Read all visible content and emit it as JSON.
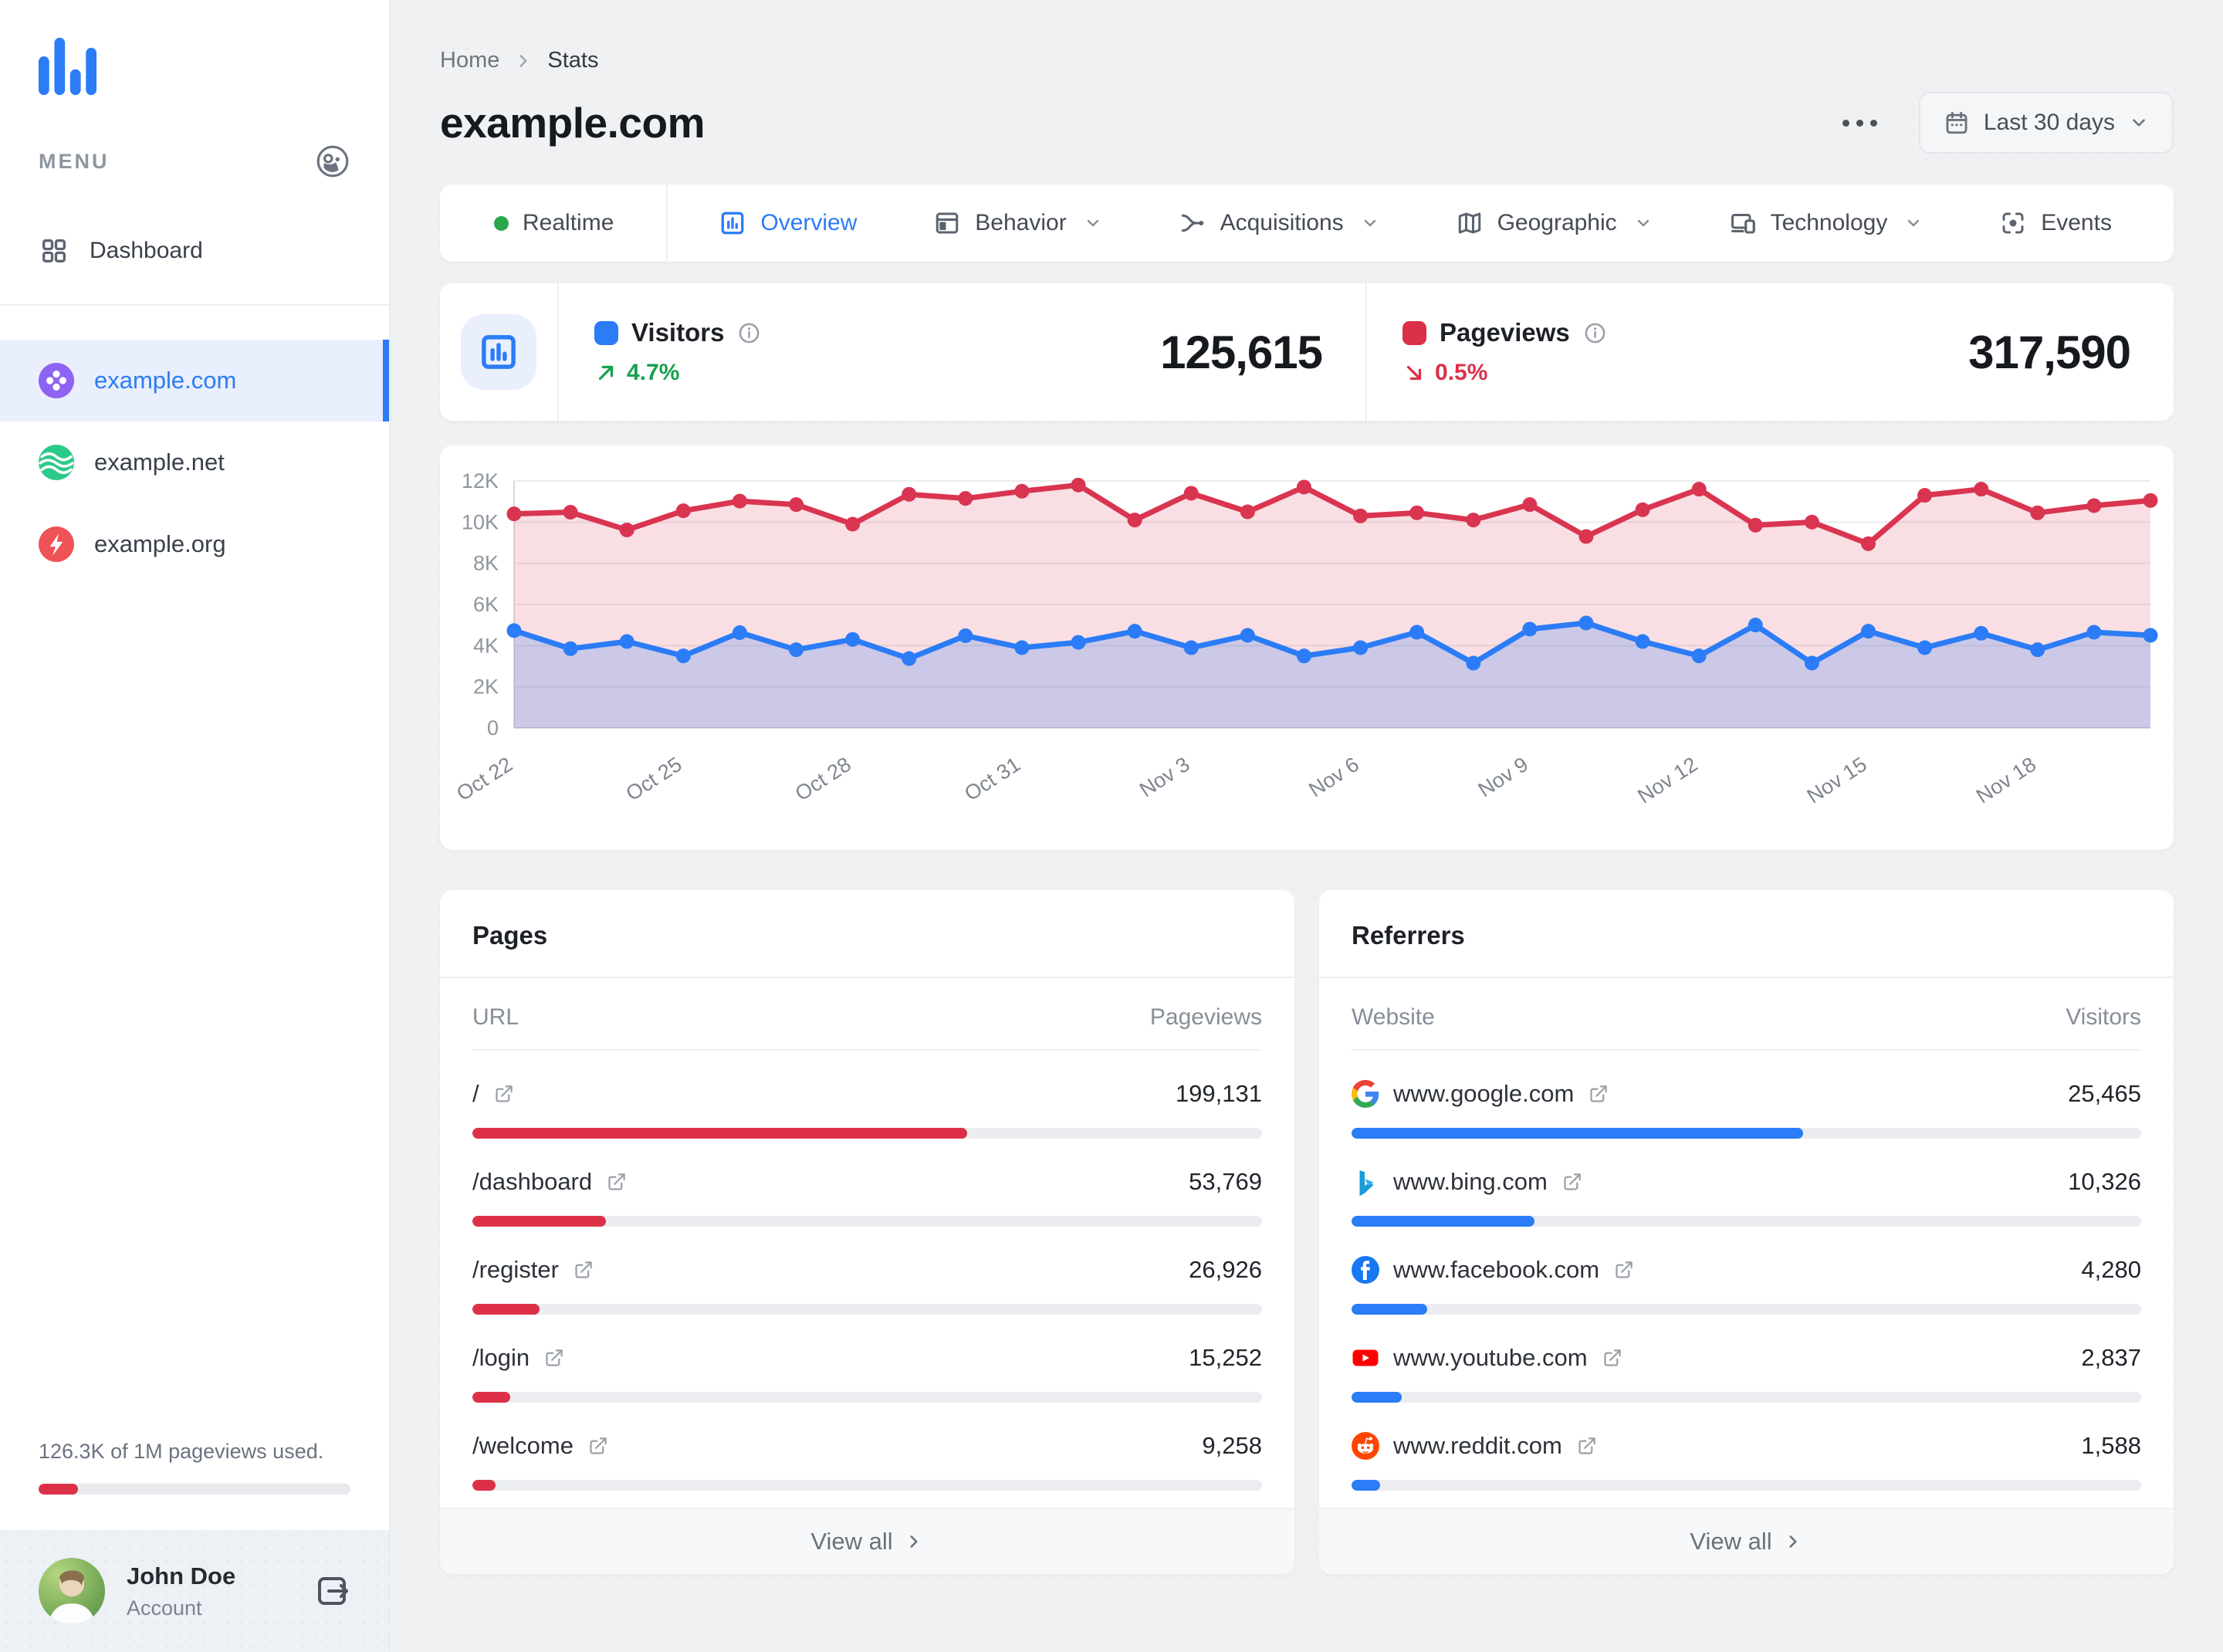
{
  "sidebar": {
    "menu_label": "MENU",
    "dashboard_label": "Dashboard",
    "sites": [
      {
        "name": "example.com",
        "selected": true
      },
      {
        "name": "example.net",
        "selected": false
      },
      {
        "name": "example.org",
        "selected": false
      }
    ],
    "usage": {
      "text": "126.3K of 1M pageviews used.",
      "percent": 12.6
    },
    "account": {
      "name": "John Doe",
      "role": "Account"
    }
  },
  "header": {
    "breadcrumb": [
      "Home",
      "Stats"
    ],
    "title": "example.com",
    "date_range": "Last 30 days"
  },
  "tabs": [
    {
      "label": "Realtime",
      "icon": "realtime-dot",
      "active": false,
      "dropdown": false
    },
    {
      "label": "Overview",
      "icon": "overview-chart-icon",
      "active": true,
      "dropdown": false
    },
    {
      "label": "Behavior",
      "icon": "behavior-window-icon",
      "active": false,
      "dropdown": true
    },
    {
      "label": "Acquisitions",
      "icon": "acquisitions-branch-icon",
      "active": false,
      "dropdown": true
    },
    {
      "label": "Geographic",
      "icon": "geographic-map-icon",
      "active": false,
      "dropdown": true
    },
    {
      "label": "Technology",
      "icon": "technology-devices-icon",
      "active": false,
      "dropdown": true
    },
    {
      "label": "Events",
      "icon": "events-scan-icon",
      "active": false,
      "dropdown": false
    }
  ],
  "overview": {
    "visitors": {
      "label": "Visitors",
      "value": "125,615",
      "change": "4.7%",
      "trend": "up"
    },
    "pageviews": {
      "label": "Pageviews",
      "value": "317,590",
      "change": "0.5%",
      "trend": "down"
    }
  },
  "chart_data": {
    "type": "area",
    "x": [
      "Oct 22",
      "Oct 23",
      "Oct 24",
      "Oct 25",
      "Oct 26",
      "Oct 27",
      "Oct 28",
      "Oct 29",
      "Oct 30",
      "Oct 31",
      "Nov 1",
      "Nov 2",
      "Nov 3",
      "Nov 4",
      "Nov 5",
      "Nov 6",
      "Nov 7",
      "Nov 8",
      "Nov 9",
      "Nov 10",
      "Nov 11",
      "Nov 12",
      "Nov 13",
      "Nov 14",
      "Nov 15",
      "Nov 16",
      "Nov 17",
      "Nov 18",
      "Nov 19",
      "Nov 20"
    ],
    "x_tick_labels": [
      "Oct 22",
      "Oct 25",
      "Oct 28",
      "Oct 31",
      "Nov 3",
      "Nov 6",
      "Nov 9",
      "Nov 12",
      "Nov 15",
      "Nov 18"
    ],
    "series": [
      {
        "name": "Pageviews",
        "color": "#d93550",
        "values": [
          10400,
          10480,
          9620,
          10550,
          11020,
          10850,
          9900,
          11350,
          11150,
          11500,
          11800,
          10100,
          11400,
          10500,
          11700,
          10300,
          10450,
          10100,
          10850,
          9300,
          10600,
          11600,
          9850,
          10000,
          8950,
          11300,
          11600,
          10450,
          10800,
          11050
        ]
      },
      {
        "name": "Visitors",
        "color": "#2b7cf6",
        "values": [
          4730,
          3850,
          4200,
          3500,
          4630,
          3800,
          4300,
          3370,
          4480,
          3900,
          4160,
          4700,
          3900,
          4500,
          3500,
          3900,
          4650,
          3150,
          4800,
          5100,
          4200,
          3500,
          5000,
          3150,
          4700,
          3900,
          4600,
          3800,
          4650,
          4500
        ]
      }
    ],
    "ylim": [
      0,
      12000
    ],
    "y_ticks": [
      "0",
      "2K",
      "4K",
      "6K",
      "8K",
      "10K",
      "12K"
    ],
    "grid": true,
    "legend_position": "none",
    "title": ""
  },
  "pages": {
    "title": "Pages",
    "col_name": "URL",
    "col_value": "Pageviews",
    "rows": [
      {
        "url": "/",
        "value": "199,131"
      },
      {
        "url": "/dashboard",
        "value": "53,769"
      },
      {
        "url": "/register",
        "value": "26,926"
      },
      {
        "url": "/login",
        "value": "15,252"
      },
      {
        "url": "/welcome",
        "value": "9,258"
      }
    ],
    "view_all": "View all",
    "bar_color": "#dc3049"
  },
  "referrers": {
    "title": "Referrers",
    "col_name": "Website",
    "col_value": "Visitors",
    "rows": [
      {
        "site": "www.google.com",
        "favicon": "google-favicon",
        "value": "25,465"
      },
      {
        "site": "www.bing.com",
        "favicon": "bing-favicon",
        "value": "10,326"
      },
      {
        "site": "www.facebook.com",
        "favicon": "facebook-favicon",
        "value": "4,280"
      },
      {
        "site": "www.youtube.com",
        "favicon": "youtube-favicon",
        "value": "2,837"
      },
      {
        "site": "www.reddit.com",
        "favicon": "reddit-favicon",
        "value": "1,588"
      }
    ],
    "view_all": "View all",
    "bar_color": "#2b7cf6"
  },
  "colors": {
    "accent_blue": "#2b7cf6",
    "accent_red": "#dc3049",
    "positive_green": "#18a04e",
    "sidebar_selected_bg": "#e9effc",
    "page_bg": "#f0f1f3"
  }
}
